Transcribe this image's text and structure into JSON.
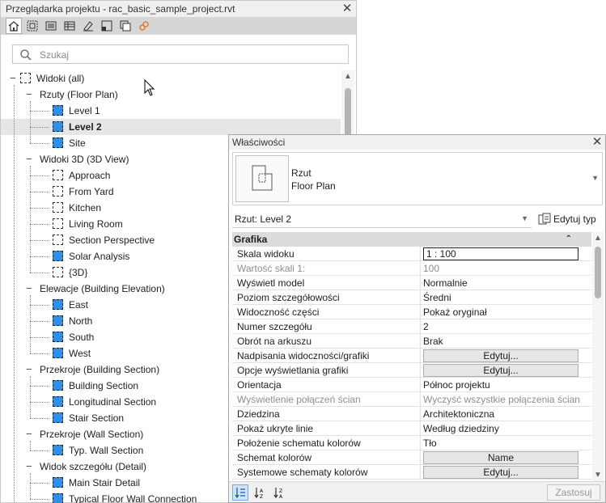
{
  "browser": {
    "title": "Przeglądarka projektu - rac_basic_sample_project.rvt",
    "close": "✕",
    "search_placeholder": "Szukaj",
    "tree": [
      {
        "label": "Widoki (all)",
        "level": 0,
        "icon": "group",
        "exp": "−"
      },
      {
        "label": "Rzuty (Floor Plan)",
        "level": 1,
        "icon": "",
        "exp": "−"
      },
      {
        "label": "Level 1",
        "level": 2,
        "icon": "plan",
        "exp": ""
      },
      {
        "label": "Level 2",
        "level": 2,
        "icon": "plan",
        "exp": "",
        "selected": true,
        "bold": true
      },
      {
        "label": "Site",
        "level": 2,
        "icon": "plan",
        "exp": ""
      },
      {
        "label": "Widoki 3D (3D View)",
        "level": 1,
        "icon": "",
        "exp": "−"
      },
      {
        "label": "Approach",
        "level": 2,
        "icon": "view3d",
        "exp": ""
      },
      {
        "label": "From Yard",
        "level": 2,
        "icon": "view3d",
        "exp": ""
      },
      {
        "label": "Kitchen",
        "level": 2,
        "icon": "view3d",
        "exp": ""
      },
      {
        "label": "Living Room",
        "level": 2,
        "icon": "view3d",
        "exp": ""
      },
      {
        "label": "Section Perspective",
        "level": 2,
        "icon": "view3d",
        "exp": ""
      },
      {
        "label": "Solar Analysis",
        "level": 2,
        "icon": "plan",
        "exp": ""
      },
      {
        "label": "{3D}",
        "level": 2,
        "icon": "view3d",
        "exp": ""
      },
      {
        "label": "Elewacje (Building Elevation)",
        "level": 1,
        "icon": "",
        "exp": "−"
      },
      {
        "label": "East",
        "level": 2,
        "icon": "plan",
        "exp": ""
      },
      {
        "label": "North",
        "level": 2,
        "icon": "plan",
        "exp": ""
      },
      {
        "label": "South",
        "level": 2,
        "icon": "plan",
        "exp": ""
      },
      {
        "label": "West",
        "level": 2,
        "icon": "plan",
        "exp": ""
      },
      {
        "label": "Przekroje (Building Section)",
        "level": 1,
        "icon": "",
        "exp": "−"
      },
      {
        "label": "Building Section",
        "level": 2,
        "icon": "plan",
        "exp": ""
      },
      {
        "label": "Longitudinal Section",
        "level": 2,
        "icon": "plan",
        "exp": ""
      },
      {
        "label": "Stair Section",
        "level": 2,
        "icon": "plan",
        "exp": ""
      },
      {
        "label": "Przekroje (Wall Section)",
        "level": 1,
        "icon": "",
        "exp": "−"
      },
      {
        "label": "Typ. Wall Section",
        "level": 2,
        "icon": "plan",
        "exp": ""
      },
      {
        "label": "Widok szczegółu (Detail)",
        "level": 1,
        "icon": "",
        "exp": "−"
      },
      {
        "label": "Main Stair Detail",
        "level": 2,
        "icon": "plan",
        "exp": ""
      },
      {
        "label": "Typical Floor Wall Connection",
        "level": 2,
        "icon": "plan",
        "exp": ""
      }
    ]
  },
  "props": {
    "title": "Właściwości",
    "close": "✕",
    "type_name_line1": "Rzut",
    "type_name_line2": "Floor Plan",
    "instance": "Rzut: Level 2",
    "edit_type": "Edytuj typ",
    "group": "Grafika",
    "rows": [
      {
        "name": "Skala widoku",
        "value": "1 : 100",
        "style": "box"
      },
      {
        "name": "Wartość skali    1:",
        "value": "100",
        "style": "dis"
      },
      {
        "name": "Wyświetl model",
        "value": "Normalnie",
        "style": ""
      },
      {
        "name": "Poziom szczegółowości",
        "value": "Średni",
        "style": ""
      },
      {
        "name": "Widoczność części",
        "value": "Pokaż oryginał",
        "style": ""
      },
      {
        "name": "Numer szczegółu",
        "value": "2",
        "style": ""
      },
      {
        "name": "Obrót na arkuszu",
        "value": "Brak",
        "style": ""
      },
      {
        "name": "Nadpisania widoczności/grafiki",
        "value": "Edytuj...",
        "style": "btn"
      },
      {
        "name": "Opcje wyświetlania grafiki",
        "value": "Edytuj...",
        "style": "btn"
      },
      {
        "name": "Orientacja",
        "value": "Północ projektu",
        "style": ""
      },
      {
        "name": "Wyświetlenie połączeń ścian",
        "value": "Wyczyść wszystkie połączenia ścian",
        "style": "dis"
      },
      {
        "name": "Dziedzina",
        "value": "Architektoniczna",
        "style": ""
      },
      {
        "name": "Pokaż ukryte linie",
        "value": "Według dziedziny",
        "style": ""
      },
      {
        "name": "Położenie schematu kolorów",
        "value": "Tło",
        "style": ""
      },
      {
        "name": "Schemat kolorów",
        "value": "Name",
        "style": "btn"
      },
      {
        "name": "Systemowe schematy kolorów",
        "value": "Edytuj...",
        "style": "btn"
      }
    ],
    "apply": "Zastosuj"
  },
  "colors": {
    "accent": "#2f8fe9",
    "toolbar": "#d6d6d6",
    "group_header": "#dcdcdc"
  }
}
